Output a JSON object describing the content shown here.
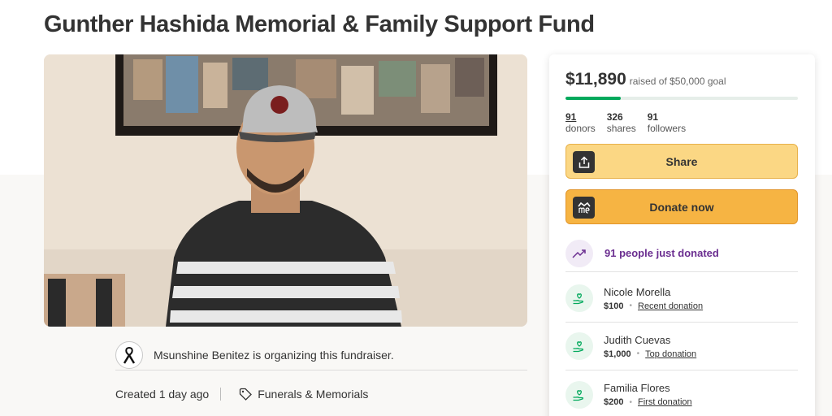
{
  "page": {
    "title": "Gunther Hashida Memorial & Family Support Fund"
  },
  "organizer": {
    "text": "Msunshine Benitez is organizing this fundraiser."
  },
  "meta": {
    "created": "Created 1 day ago",
    "category": "Funerals & Memorials"
  },
  "card": {
    "raised_amount": "$11,890",
    "raised_goal": "raised of $50,000 goal",
    "progress_fraction": 0.2378,
    "stats": [
      {
        "num": "91",
        "label": "donors"
      },
      {
        "num": "326",
        "label": "shares"
      },
      {
        "num": "91",
        "label": "followers"
      }
    ],
    "share_label": "Share",
    "donate_label": "Donate now",
    "trend_text": "91 people just donated",
    "donations": [
      {
        "name": "Nicole Morella",
        "amount": "$100",
        "tag": "Recent donation"
      },
      {
        "name": "Judith Cuevas",
        "amount": "$1,000",
        "tag": "Top donation"
      },
      {
        "name": "Familia Flores",
        "amount": "$200",
        "tag": "First donation"
      }
    ]
  },
  "colors": {
    "accent_green": "#02a95c",
    "share_yellow": "#fbd784",
    "donate_orange": "#f6b443",
    "trend_purple": "#6b2e90"
  },
  "icons": {
    "share": "share-icon",
    "donate": "gofundme-logo-icon",
    "trend": "trending-up-icon",
    "donor": "donor-heart-hand-icon",
    "tag": "tag-icon",
    "avatar": "mourning-ribbon-icon"
  }
}
